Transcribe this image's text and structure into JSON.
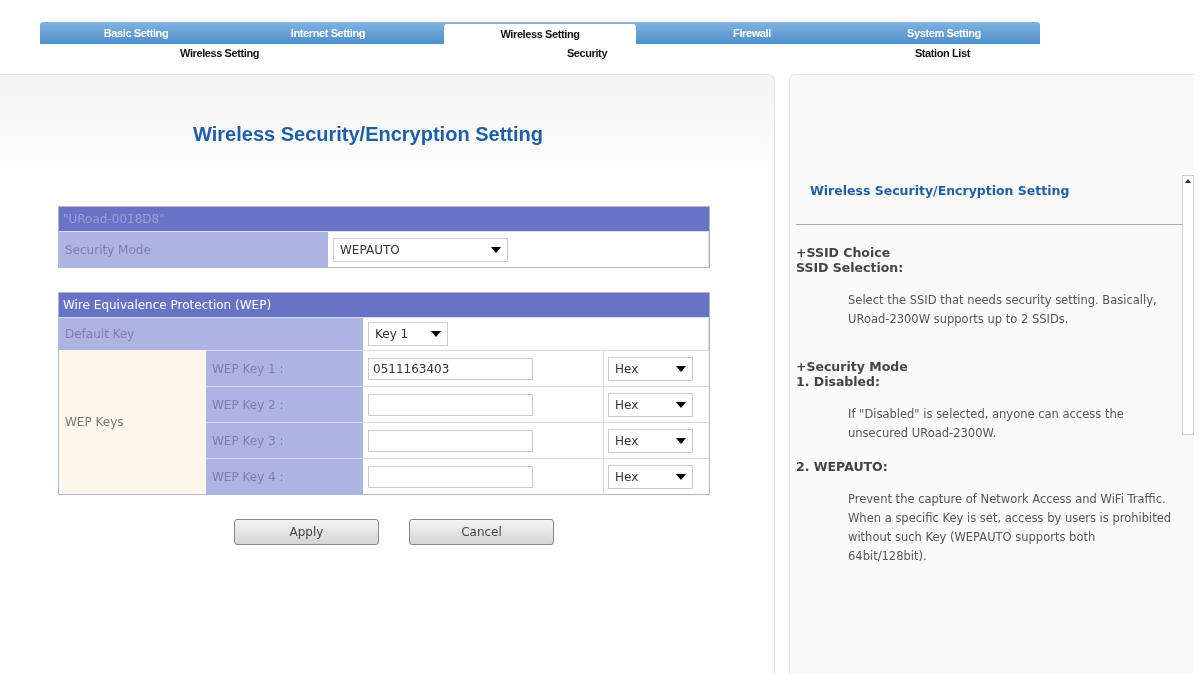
{
  "tabs": [
    {
      "label": "Basic Setting",
      "selected": false
    },
    {
      "label": "Internet Setting",
      "selected": false
    },
    {
      "label": "Wireless Setting",
      "selected": true
    },
    {
      "label": "Firewall",
      "selected": false
    },
    {
      "label": "System Setting",
      "selected": false
    }
  ],
  "subtabs": [
    {
      "label": "Wireless Setting"
    },
    {
      "label": "Security"
    },
    {
      "label": "Station List"
    }
  ],
  "title": "Wireless Security/Encryption Setting",
  "ssid_table": {
    "header": "\"URoad-0018D8\"",
    "label": "Security Mode",
    "value": "WEPAUTO"
  },
  "wep_table": {
    "header": "Wire Equivalence Protection (WEP)",
    "default_key_label": "Default Key",
    "default_key_value": "Key 1",
    "group_label": "WEP Keys",
    "keys": [
      {
        "label": "WEP Key 1 :",
        "value": "0511163403",
        "format": "Hex"
      },
      {
        "label": "WEP Key 2 :",
        "format": "Hex"
      },
      {
        "label": "WEP Key 3 :",
        "format": "Hex"
      },
      {
        "label": "WEP Key 4 :",
        "format": "Hex"
      }
    ]
  },
  "buttons": [
    "Apply",
    "Cancel"
  ],
  "help": {
    "title": "Wireless Security/Encryption Setting",
    "blocks": [
      {
        "kind": "heading",
        "text": "+SSID Choice"
      },
      {
        "kind": "subheading",
        "text": "SSID Selection:"
      },
      {
        "kind": "text",
        "text": "Select the SSID that needs security setting. Basically, URoad-2300W supports up to 2 SSIDs."
      },
      {
        "kind": "heading",
        "text": "+Security Mode"
      },
      {
        "kind": "subheading",
        "text": "1. Disabled:"
      },
      {
        "kind": "text",
        "text": "If \"Disabled\" is selected, anyone can access the unsecured URoad-2300W."
      },
      {
        "kind": "subheading",
        "text": "2. WEPAUTO:"
      },
      {
        "kind": "text",
        "text": "Prevent the capture of Network Access and WiFi Traffic. When a specific Key is set, access by users is prohibited without such Key (WEPAUTO supports both 64bit/128bit)."
      }
    ]
  }
}
